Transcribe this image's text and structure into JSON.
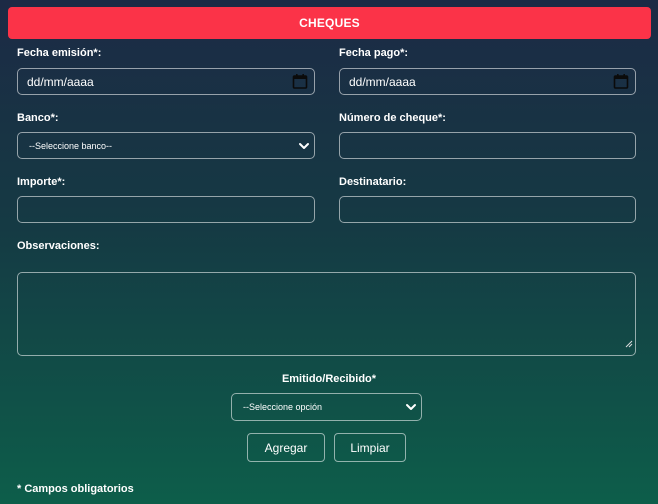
{
  "header": {
    "title": "CHEQUES"
  },
  "form": {
    "fecha_emision": {
      "label": "Fecha emisión*:",
      "value": "dd/mm/aaaa"
    },
    "fecha_pago": {
      "label": "Fecha pago*:",
      "value": "dd/mm/aaaa"
    },
    "banco": {
      "label": "Banco*:",
      "selected": "--Seleccione banco--"
    },
    "numero_cheque": {
      "label": "Número de cheque*:",
      "value": ""
    },
    "importe": {
      "label": "Importe*:",
      "value": ""
    },
    "destinatario": {
      "label": "Destinatario:",
      "value": ""
    },
    "observaciones": {
      "label": "Observaciones:",
      "value": ""
    },
    "emitido_recibido": {
      "label": "Emitido/Recibido*",
      "selected": "--Seleccione opción"
    }
  },
  "actions": {
    "add_label": "Agregar",
    "clear_label": "Limpiar"
  },
  "footer": {
    "required_note": "* Campos obligatorios"
  },
  "colors": {
    "header_bg": "#fb3348",
    "bg_top": "#1c2a45",
    "bg_bottom": "#0d5e4a"
  },
  "icons": {
    "date": "calendar-icon",
    "select": "chevron-down-icon",
    "textarea": "resize-grip-icon"
  }
}
